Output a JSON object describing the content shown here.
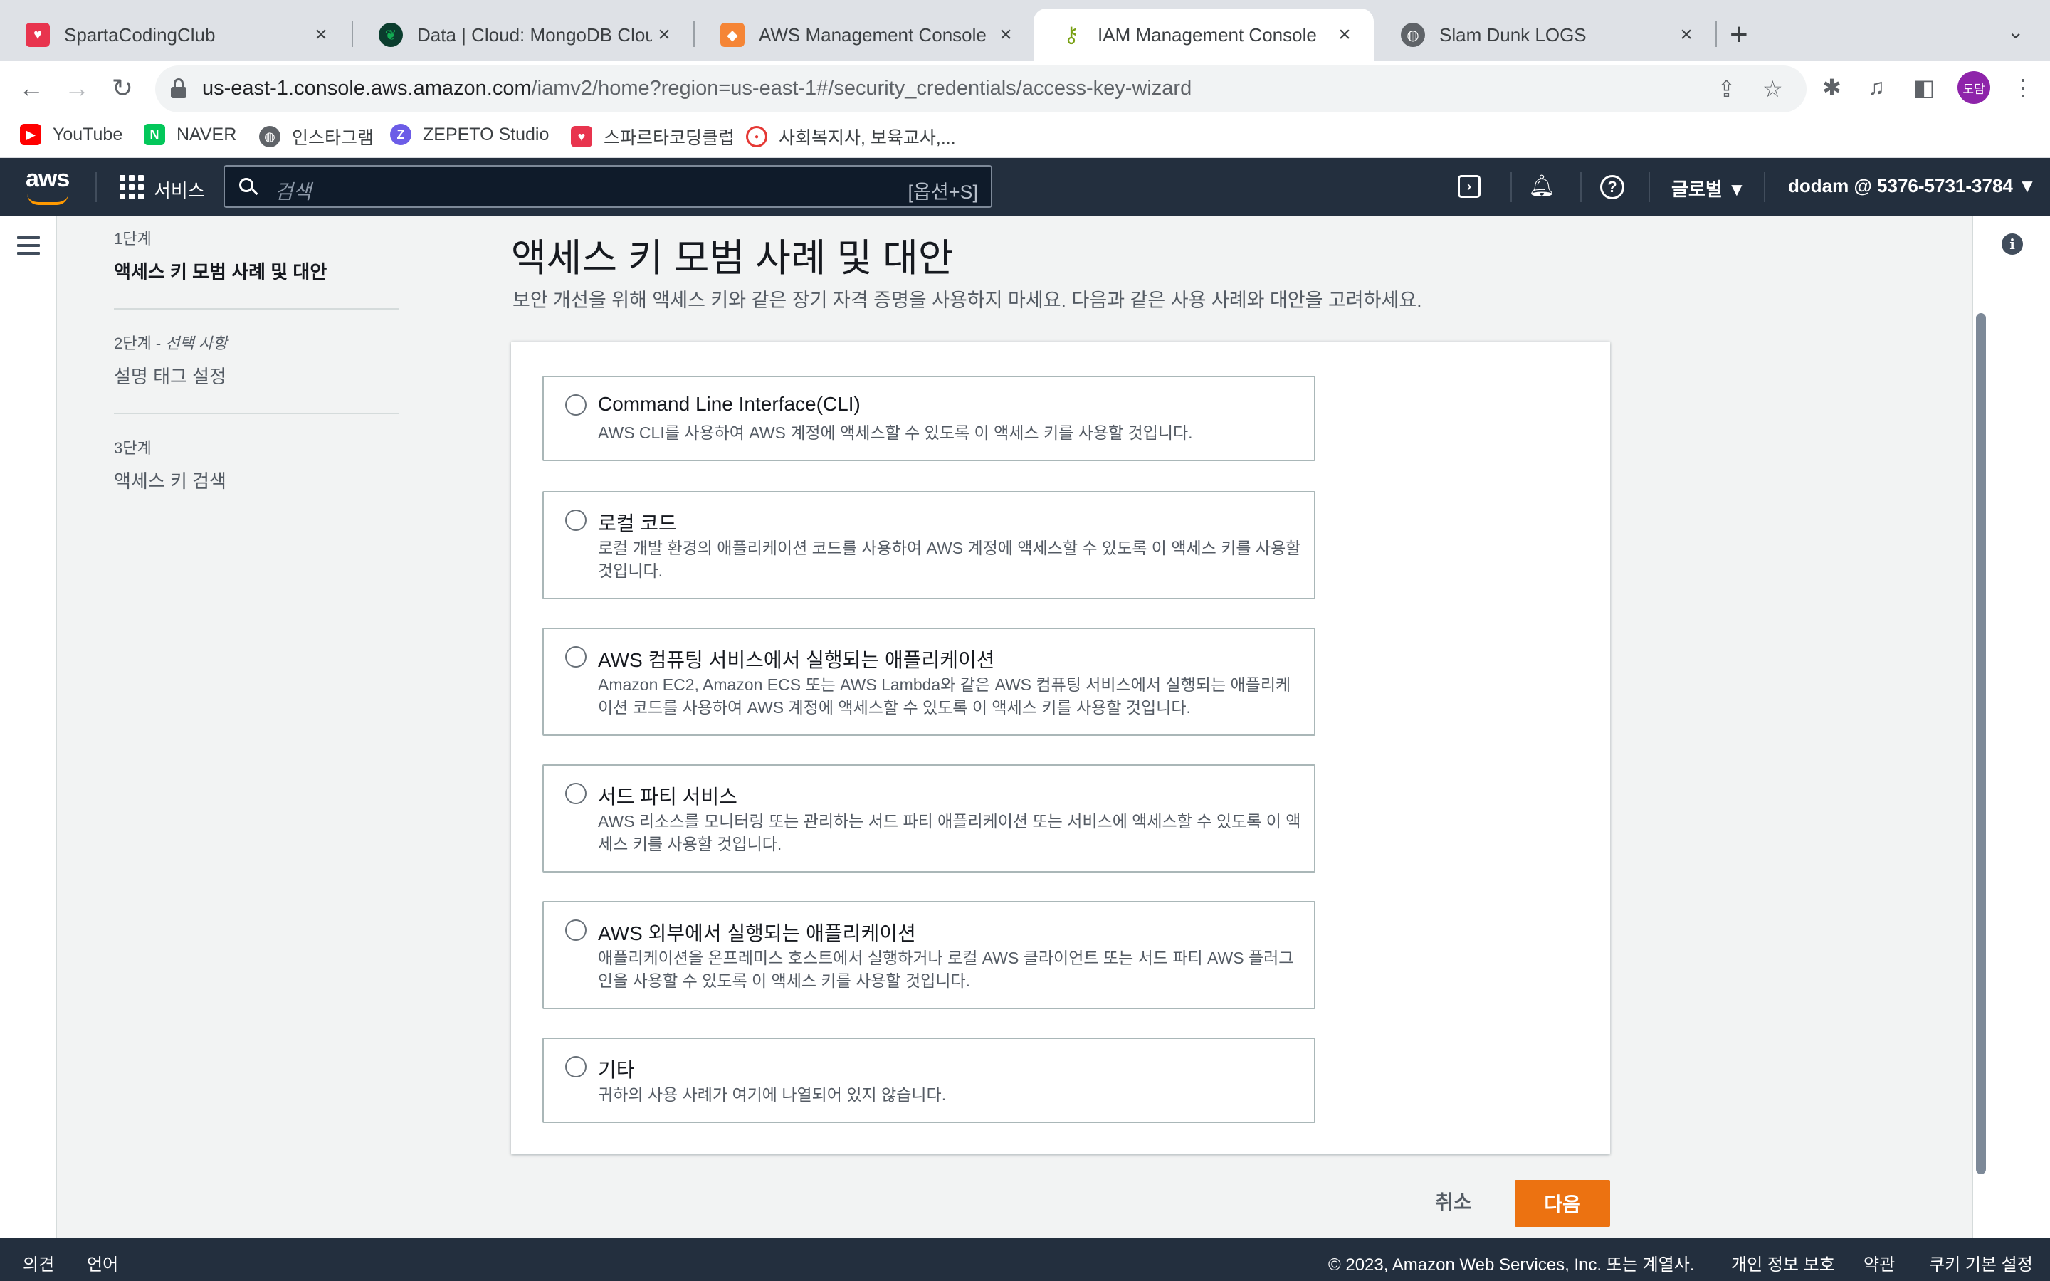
{
  "browser": {
    "tabs": [
      {
        "title": "SpartaCodingClub",
        "favicon": "sparta-icon",
        "color": "#e8344e"
      },
      {
        "title": "Data | Cloud: MongoDB Cloud",
        "favicon": "mongodb-leaf-icon",
        "color": "#13aa52"
      },
      {
        "title": "AWS Management Console",
        "favicon": "aws-box-icon",
        "color": "#f58536"
      },
      {
        "title": "IAM Management Console",
        "favicon": "iam-key-icon",
        "color": "#7aa116"
      },
      {
        "title": "Slam Dunk LOGS",
        "favicon": "globe-icon",
        "color": "#5f6368"
      }
    ],
    "address": {
      "domain": "us-east-1.console.aws.amazon.com",
      "path": "/iamv2/home?region=us-east-1#/security_credentials/access-key-wizard"
    },
    "profile_initials": "도담",
    "bookmarks": [
      {
        "label": "YouTube",
        "icon": "youtube-icon",
        "color": "#ff0000"
      },
      {
        "label": "NAVER",
        "icon": "naver-icon",
        "color": "#03c75a"
      },
      {
        "label": "인스타그램",
        "icon": "globe-icon",
        "color": "#5f6368"
      },
      {
        "label": "ZEPETO Studio",
        "icon": "zepeto-icon",
        "color": "#6c5ce7"
      },
      {
        "label": "스파르타코딩클럽",
        "icon": "sparta-icon",
        "color": "#e8344e"
      },
      {
        "label": "사회복지사, 보육교사,...",
        "icon": "circle-logo-icon",
        "color": "#e53935"
      }
    ]
  },
  "aws_nav": {
    "logo": "aws",
    "services": "서비스",
    "search_placeholder": "검색",
    "search_shortcut": "[옵션+S]",
    "region": "글로벌 ▼",
    "account": "dodam @ 5376-5731-3784 ▼"
  },
  "steps": [
    {
      "sub": "1단계",
      "optional": "",
      "title": "액세스 키 모범 사례 및 대안",
      "active": true
    },
    {
      "sub": "2단계 - ",
      "optional": "선택 사항",
      "title": "설명 태그 설정",
      "active": false
    },
    {
      "sub": "3단계",
      "optional": "",
      "title": "액세스 키 검색",
      "active": false
    }
  ],
  "main": {
    "title": "액세스 키 모범 사례 및 대안",
    "description": "보안 개선을 위해 액세스 키와 같은 장기 자격 증명을 사용하지 마세요. 다음과 같은 사용 사례와 대안을 고려하세요.",
    "options": [
      {
        "title": "Command Line Interface(CLI)",
        "desc": "AWS CLI를 사용하여 AWS 계정에 액세스할 수 있도록 이 액세스 키를 사용할 것입니다."
      },
      {
        "title": "로컬 코드",
        "desc": "로컬 개발 환경의 애플리케이션 코드를 사용하여 AWS 계정에 액세스할 수 있도록 이 액세스 키를 사용할 것입니다."
      },
      {
        "title": "AWS 컴퓨팅 서비스에서 실행되는 애플리케이션",
        "desc": "Amazon EC2, Amazon ECS 또는 AWS Lambda와 같은 AWS 컴퓨팅 서비스에서 실행되는 애플리케이션 코드를 사용하여 AWS 계정에 액세스할 수 있도록 이 액세스 키를 사용할 것입니다."
      },
      {
        "title": "서드 파티 서비스",
        "desc": "AWS 리소스를 모니터링 또는 관리하는 서드 파티 애플리케이션 또는 서비스에 액세스할 수 있도록 이 액세스 키를 사용할 것입니다."
      },
      {
        "title": "AWS 외부에서 실행되는 애플리케이션",
        "desc": "애플리케이션을 온프레미스 호스트에서 실행하거나 로컬 AWS 클라이언트 또는 서드 파티 AWS 플러그인을 사용할 수 있도록 이 액세스 키를 사용할 것입니다."
      },
      {
        "title": "기타",
        "desc": "귀하의 사용 사례가 여기에 나열되어 있지 않습니다."
      }
    ],
    "cancel_label": "취소",
    "next_label": "다음"
  },
  "footer": {
    "feedback": "의견",
    "language": "언어",
    "copyright": "© 2023, Amazon Web Services, Inc. 또는 계열사.",
    "privacy": "개인 정보 보호",
    "terms": "약관",
    "cookies": "쿠키 기본 설정"
  },
  "colors": {
    "aws_nav_bg": "#232f3e",
    "primary_button": "#ec7211",
    "aws_orange": "#ff9900"
  }
}
